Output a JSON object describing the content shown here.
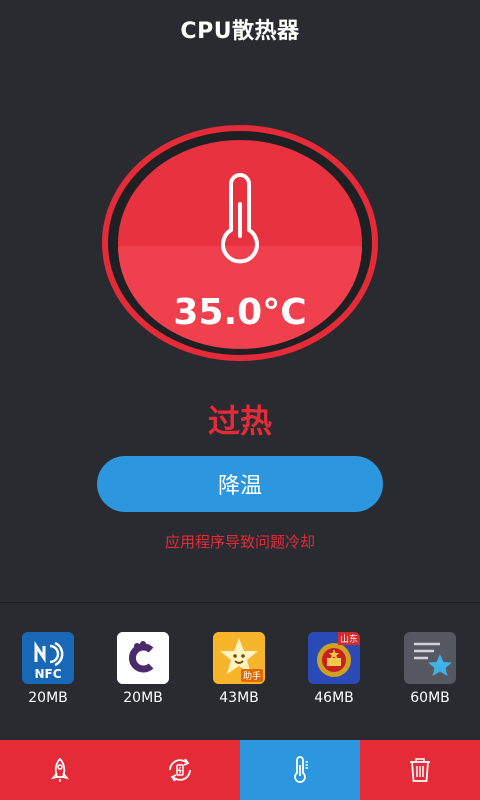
{
  "header": {
    "title": "CPU散热器"
  },
  "gauge": {
    "temperature": "35.0°C"
  },
  "status": {
    "label": "过热"
  },
  "action": {
    "cool_label": "降温"
  },
  "hint": {
    "text": "应用程序导致问题冷却"
  },
  "apps": [
    {
      "size": "20MB",
      "icon": "nfc-app-icon",
      "icon_text": "NFC"
    },
    {
      "size": "20MB",
      "icon": "c-app-icon"
    },
    {
      "size": "43MB",
      "icon": "star-helper-app-icon",
      "badge": "助手"
    },
    {
      "size": "46MB",
      "icon": "emblem-app-icon",
      "badge": "山东"
    },
    {
      "size": "60MB",
      "icon": "notes-star-app-icon"
    }
  ],
  "nav": [
    {
      "icon": "rocket-icon"
    },
    {
      "icon": "refresh-battery-icon"
    },
    {
      "icon": "thermometer-icon",
      "active": true
    },
    {
      "icon": "trash-icon"
    }
  ],
  "colors": {
    "accent_red": "#e52b38",
    "accent_blue": "#2c97de",
    "background": "#2a2b30"
  }
}
